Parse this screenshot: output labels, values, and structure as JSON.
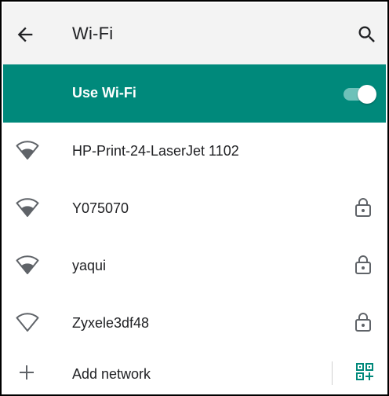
{
  "appbar": {
    "title": "Wi-Fi",
    "back_icon": "arrow-back-icon",
    "search_icon": "search-icon"
  },
  "master_switch": {
    "label": "Use Wi-Fi",
    "state": "on"
  },
  "networks": [
    {
      "name": "HP-Print-24-LaserJet 1102",
      "secured": false
    },
    {
      "name": "Y075070",
      "secured": true
    },
    {
      "name": "yaqui",
      "secured": true
    },
    {
      "name": "Zyxele3df48",
      "secured": true
    }
  ],
  "add_network": {
    "label": "Add network",
    "qr_icon": "qr-code-add-icon"
  },
  "colors": {
    "accent": "#00897b",
    "appbar_bg": "#f3f3f3",
    "icon": "#5f6368",
    "text": "#202124"
  }
}
